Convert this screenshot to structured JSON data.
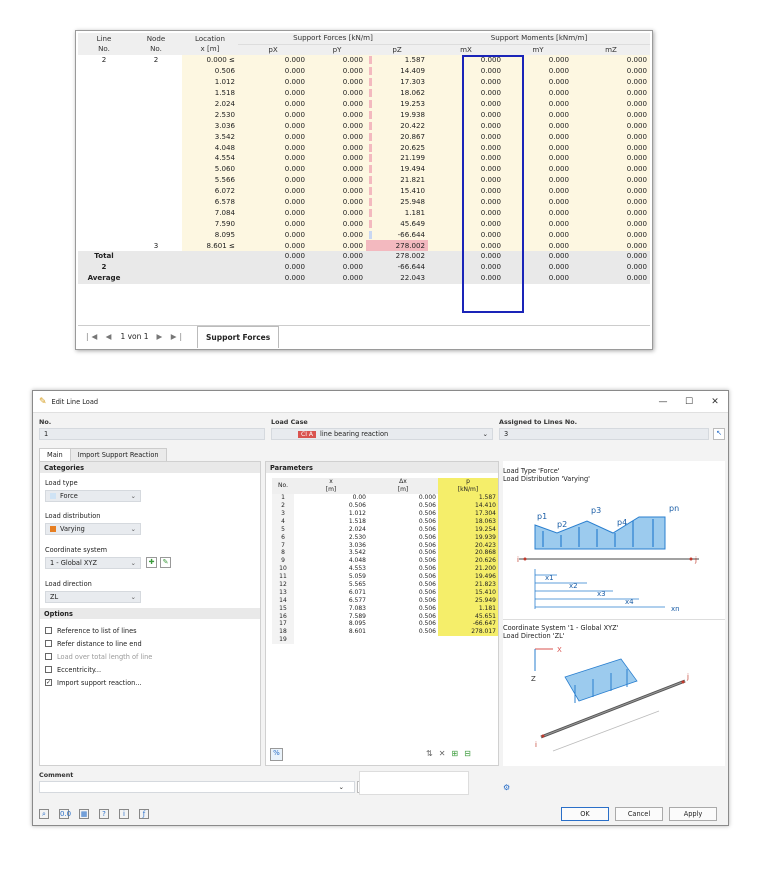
{
  "table": {
    "col_headers": [
      "Line\nNo.",
      "Node\nNo.",
      "Location\nx [m]",
      "pX",
      "pY",
      "pZ",
      "mX",
      "mY",
      "mZ"
    ],
    "group_forces": "Support Forces [kN/m]",
    "group_moments": "Support Moments [kNm/m]",
    "rows": [
      {
        "line": "2",
        "node": "2",
        "x": "0.000 ≤",
        "px": "0.000",
        "py": "0.000",
        "pz": "1.587",
        "mx": "0.000",
        "my": "0.000",
        "mz": "0.000"
      },
      {
        "line": "",
        "node": "",
        "x": "0.506",
        "px": "0.000",
        "py": "0.000",
        "pz": "14.409",
        "mx": "0.000",
        "my": "0.000",
        "mz": "0.000"
      },
      {
        "line": "",
        "node": "",
        "x": "1.012",
        "px": "0.000",
        "py": "0.000",
        "pz": "17.303",
        "mx": "0.000",
        "my": "0.000",
        "mz": "0.000"
      },
      {
        "line": "",
        "node": "",
        "x": "1.518",
        "px": "0.000",
        "py": "0.000",
        "pz": "18.062",
        "mx": "0.000",
        "my": "0.000",
        "mz": "0.000"
      },
      {
        "line": "",
        "node": "",
        "x": "2.024",
        "px": "0.000",
        "py": "0.000",
        "pz": "19.253",
        "mx": "0.000",
        "my": "0.000",
        "mz": "0.000"
      },
      {
        "line": "",
        "node": "",
        "x": "2.530",
        "px": "0.000",
        "py": "0.000",
        "pz": "19.938",
        "mx": "0.000",
        "my": "0.000",
        "mz": "0.000"
      },
      {
        "line": "",
        "node": "",
        "x": "3.036",
        "px": "0.000",
        "py": "0.000",
        "pz": "20.422",
        "mx": "0.000",
        "my": "0.000",
        "mz": "0.000"
      },
      {
        "line": "",
        "node": "",
        "x": "3.542",
        "px": "0.000",
        "py": "0.000",
        "pz": "20.867",
        "mx": "0.000",
        "my": "0.000",
        "mz": "0.000"
      },
      {
        "line": "",
        "node": "",
        "x": "4.048",
        "px": "0.000",
        "py": "0.000",
        "pz": "20.625",
        "mx": "0.000",
        "my": "0.000",
        "mz": "0.000"
      },
      {
        "line": "",
        "node": "",
        "x": "4.554",
        "px": "0.000",
        "py": "0.000",
        "pz": "21.199",
        "mx": "0.000",
        "my": "0.000",
        "mz": "0.000"
      },
      {
        "line": "",
        "node": "",
        "x": "5.060",
        "px": "0.000",
        "py": "0.000",
        "pz": "19.494",
        "mx": "0.000",
        "my": "0.000",
        "mz": "0.000"
      },
      {
        "line": "",
        "node": "",
        "x": "5.566",
        "px": "0.000",
        "py": "0.000",
        "pz": "21.821",
        "mx": "0.000",
        "my": "0.000",
        "mz": "0.000"
      },
      {
        "line": "",
        "node": "",
        "x": "6.072",
        "px": "0.000",
        "py": "0.000",
        "pz": "15.410",
        "mx": "0.000",
        "my": "0.000",
        "mz": "0.000"
      },
      {
        "line": "",
        "node": "",
        "x": "6.578",
        "px": "0.000",
        "py": "0.000",
        "pz": "25.948",
        "mx": "0.000",
        "my": "0.000",
        "mz": "0.000"
      },
      {
        "line": "",
        "node": "",
        "x": "7.084",
        "px": "0.000",
        "py": "0.000",
        "pz": "1.181",
        "mx": "0.000",
        "my": "0.000",
        "mz": "0.000"
      },
      {
        "line": "",
        "node": "",
        "x": "7.590",
        "px": "0.000",
        "py": "0.000",
        "pz": "45.649",
        "mx": "0.000",
        "my": "0.000",
        "mz": "0.000"
      },
      {
        "line": "",
        "node": "",
        "x": "8.095",
        "px": "0.000",
        "py": "0.000",
        "pz": "-66.644",
        "mx": "0.000",
        "my": "0.000",
        "mz": "0.000"
      },
      {
        "line": "",
        "node": "3",
        "x": "8.601 ≤",
        "px": "0.000",
        "py": "0.000",
        "pz": "278.002",
        "mx": "0.000",
        "my": "0.000",
        "mz": "0.000"
      }
    ],
    "summary": [
      {
        "label": "Total",
        "px": "0.000",
        "py": "0.000",
        "pz": "278.002",
        "mx": "0.000",
        "my": "0.000",
        "mz": "0.000"
      },
      {
        "label": "2",
        "px": "0.000",
        "py": "0.000",
        "pz": "-66.644",
        "mx": "0.000",
        "my": "0.000",
        "mz": "0.000"
      },
      {
        "label": "Average",
        "px": "0.000",
        "py": "0.000",
        "pz": "22.043",
        "mx": "0.000",
        "my": "0.000",
        "mz": "0.000"
      }
    ],
    "pager_text": "1 von 1",
    "tab_label": "Support Forces"
  },
  "dialog": {
    "title": "Edit Line Load",
    "no_label": "No.",
    "no_value": "1",
    "load_case_label": "Load Case",
    "load_case_badge": "CI A",
    "load_case_value": "line bearing reaction",
    "assigned_label": "Assigned to Lines No.",
    "assigned_value": "3",
    "tabs": [
      "Main",
      "Import Support Reaction"
    ],
    "categories_title": "Categories",
    "load_type_label": "Load type",
    "load_type_value": "Force",
    "load_dist_label": "Load distribution",
    "load_dist_value": "Varying",
    "coord_label": "Coordinate system",
    "coord_value": "1 - Global XYZ",
    "dir_label": "Load direction",
    "dir_value": "ZL",
    "options_title": "Options",
    "options": [
      {
        "label": "Reference to list of lines",
        "checked": false,
        "disabled": false
      },
      {
        "label": "Refer distance to line end",
        "checked": false,
        "disabled": false
      },
      {
        "label": "Load over total length of line",
        "checked": false,
        "disabled": true
      },
      {
        "label": "Eccentricity...",
        "checked": false,
        "disabled": false
      },
      {
        "label": "Import support reaction...",
        "checked": true,
        "disabled": false
      }
    ],
    "params_title": "Parameters",
    "params_headers": [
      "No.",
      "x\n[m]",
      "Δx\n[m]",
      "p\n[kN/m]"
    ],
    "params_rows": [
      [
        "1",
        "0.00",
        "0.000",
        "1.587"
      ],
      [
        "2",
        "0.506",
        "0.506",
        "14.410"
      ],
      [
        "3",
        "1.012",
        "0.506",
        "17.304"
      ],
      [
        "4",
        "1.518",
        "0.506",
        "18.063"
      ],
      [
        "5",
        "2.024",
        "0.506",
        "19.254"
      ],
      [
        "6",
        "2.530",
        "0.506",
        "19.939"
      ],
      [
        "7",
        "3.036",
        "0.506",
        "20.423"
      ],
      [
        "8",
        "3.542",
        "0.506",
        "20.868"
      ],
      [
        "9",
        "4.048",
        "0.506",
        "20.626"
      ],
      [
        "10",
        "4.553",
        "0.506",
        "21.200"
      ],
      [
        "11",
        "5.059",
        "0.506",
        "19.496"
      ],
      [
        "12",
        "5.565",
        "0.506",
        "21.823"
      ],
      [
        "13",
        "6.071",
        "0.506",
        "15.410"
      ],
      [
        "14",
        "6.577",
        "0.506",
        "25.949"
      ],
      [
        "15",
        "7.083",
        "0.506",
        "1.181"
      ],
      [
        "16",
        "7.589",
        "0.506",
        "45.651"
      ],
      [
        "17",
        "8.095",
        "0.506",
        "-66.647"
      ],
      [
        "18",
        "8.601",
        "0.506",
        "278.017"
      ],
      [
        "19",
        "",
        "",
        ""
      ]
    ],
    "diag_text1": "Load Type 'Force'",
    "diag_text2": "Load Distribution 'Varying'",
    "diag_text3": "Coordinate System '1 - Global XYZ'",
    "diag_text4": "Load Direction 'ZL'",
    "diag_labels": {
      "p1": "p1",
      "p2": "p2",
      "p3": "p3",
      "p4": "p4",
      "pn": "pn",
      "i": "i",
      "j": "j",
      "x1": "x1",
      "x2": "x2",
      "x3": "x3",
      "x4": "x4",
      "xn": "xn",
      "ax": "X",
      "az": "Z"
    },
    "comment_label": "Comment",
    "ok": "OK",
    "cancel": "Cancel",
    "apply": "Apply",
    "colors": {
      "accent": "#2a6fc8",
      "highlight": "#f5ee6a",
      "load_blue": "#5aa7e0"
    }
  }
}
